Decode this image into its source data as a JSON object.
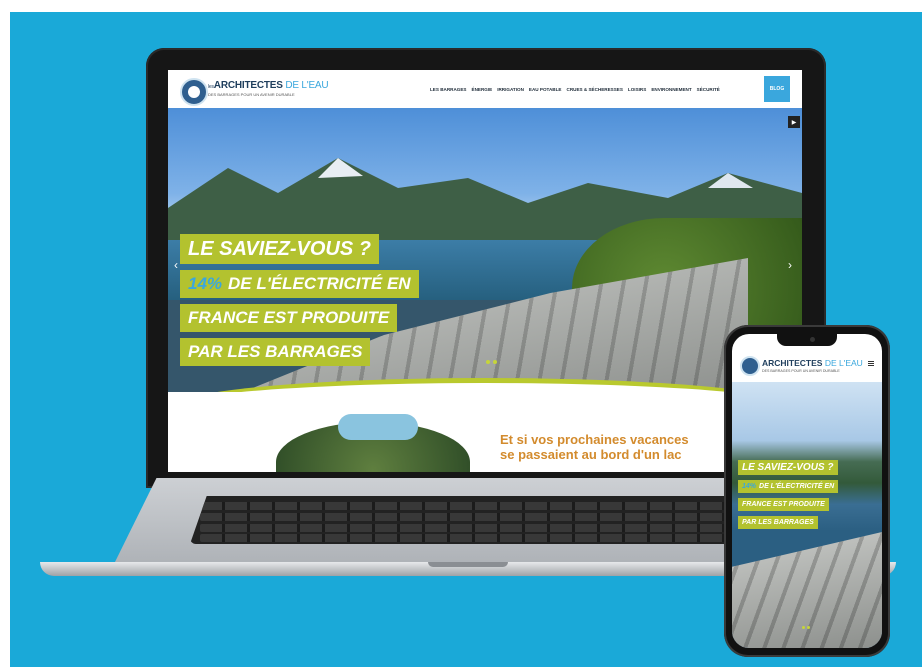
{
  "site": {
    "logo": {
      "title_main": "ARCHITECTES",
      "title_accent": "DE L'EAU",
      "prefix": "les",
      "tagline": "DES BARRAGES POUR UN AVENIR DURABLE"
    },
    "nav": [
      "LES BARRAGES",
      "ÉNERGIE",
      "IRRIGATION",
      "EAU POTABLE",
      "CRUES & SÉCHERESSES",
      "LOISIRS",
      "ENVIRONNEMENT",
      "SÉCURITÉ"
    ],
    "blog_label": "BLOG",
    "hero": {
      "line1": "LE SAVIEZ-VOUS ?",
      "line2_pct": "14%",
      "line2_rest": "DE L'ÉLECTRICITÉ EN",
      "line3": "FRANCE EST PRODUITE",
      "line4": "PAR LES BARRAGES"
    },
    "promo": "Et si vos prochaines vacances se passaient au bord d'un lac"
  },
  "colors": {
    "background": "#1aa9d8",
    "band": "#b3c22f",
    "accent": "#3aa7dd",
    "promo": "#d38b2d"
  },
  "icons": {
    "slider_next": "play-icon",
    "prev": "chevron-left-icon",
    "next": "chevron-right-icon",
    "menu": "hamburger-icon"
  }
}
